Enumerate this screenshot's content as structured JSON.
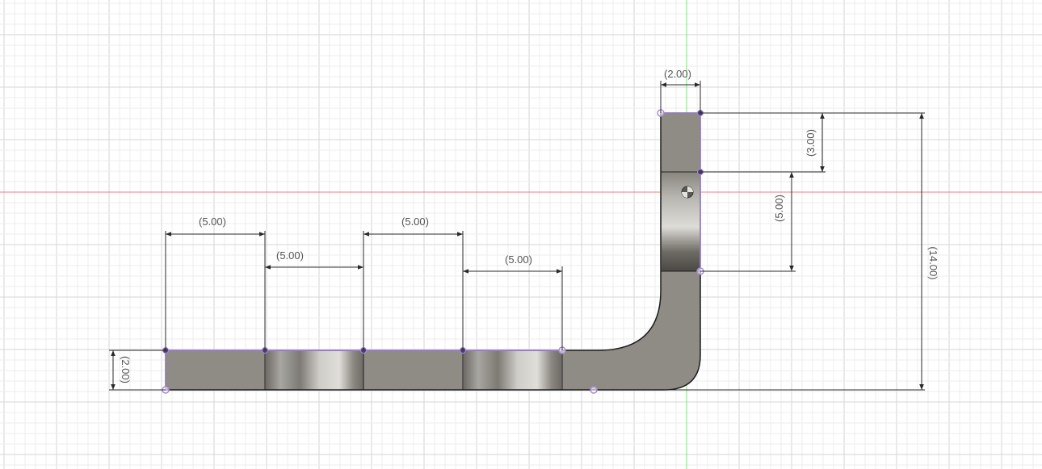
{
  "colors": {
    "background": "#ffffff",
    "grid_minor": "#ececec",
    "grid_major": "#d6d6d6",
    "axis_x": "#e88080",
    "axis_y": "#7fdc7f",
    "body_fill": "#8f8c86",
    "body_stroke": "#1f1f1f",
    "sketch_line": "#a98bd8",
    "point_fill": "#4a3d6b",
    "dimension_text": "#555555"
  },
  "dimensions": {
    "seg1": "(5.00)",
    "seg2": "(5.00)",
    "seg3": "(5.00)",
    "seg4": "(5.00)",
    "top_width": "(2.00)",
    "upper_height": "(3.00)",
    "mid_height": "(5.00)",
    "total_height": "(14.00)",
    "base_thickness": "(2.00)"
  },
  "icons": {
    "origin": "origin-marker-icon"
  }
}
